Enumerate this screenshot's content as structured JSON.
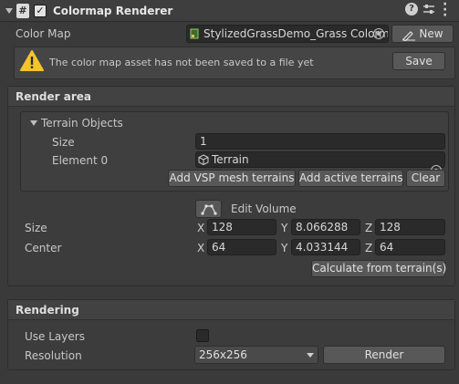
{
  "component": {
    "title": "Colormap Renderer",
    "enabled": true
  },
  "color_map": {
    "label": "Color Map",
    "value": "StylizedGrassDemo_Grass Colorm",
    "new_label": "New"
  },
  "warning": {
    "text": "The color map asset has not been saved to a file yet",
    "save_label": "Save"
  },
  "render_area": {
    "title": "Render area",
    "terrain_objects": {
      "label": "Terrain Objects",
      "size_label": "Size",
      "size_value": "1",
      "element0_label": "Element 0",
      "element0_value": "Terrain"
    },
    "buttons": {
      "add_vsp": "Add VSP mesh terrains",
      "add_active": "Add active terrains",
      "clear": "Clear"
    },
    "edit_volume_label": "Edit Volume",
    "size": {
      "label": "Size",
      "x": "128",
      "y": "8.066288",
      "z": "128"
    },
    "center": {
      "label": "Center",
      "x": "64",
      "y": "4.033144",
      "z": "64"
    },
    "axes": {
      "x": "X",
      "y": "Y",
      "z": "Z"
    },
    "calculate_label": "Calculate from terrain(s)"
  },
  "rendering": {
    "title": "Rendering",
    "use_layers_label": "Use Layers",
    "use_layers": false,
    "resolution_label": "Resolution",
    "resolution_value": "256x256",
    "render_label": "Render"
  }
}
